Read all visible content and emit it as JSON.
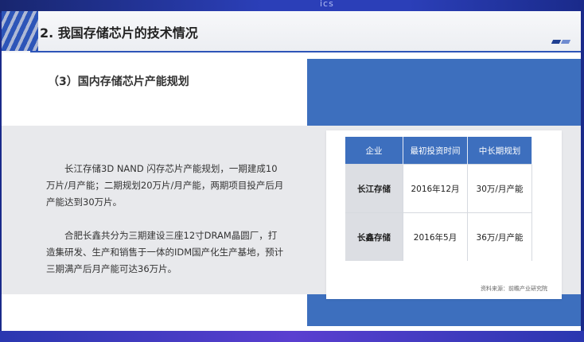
{
  "topband": {
    "text": "ics"
  },
  "header": {
    "title": "2.  我国存储芯片的技术情况"
  },
  "section": {
    "subtitle": "（3）国内存储芯片产能规划"
  },
  "paragraphs": [
    "长江存储3D NAND 闪存芯片产能规划，一期建成10万片/月产能；二期规划20万片/月产能，两期项目投产后月产能达到30万片。",
    "合肥长鑫共分为三期建设三座12寸DRAM晶圆厂，打造集研发、生产和销售于一体的IDM国产化生产基地，预计三期满产后月产能可达36万片。"
  ],
  "table": {
    "headers": [
      "企业",
      "最初投资时间",
      "中长期规划"
    ],
    "rows": [
      [
        "长江存储",
        "2016年12月",
        "30万/月产能"
      ],
      [
        "长鑫存储",
        "2016年5月",
        "36万/月产能"
      ]
    ],
    "source": "资料来源：前瞻产业研究院"
  },
  "colors": {
    "accent": "#3d6fbe",
    "header_line": "#2d55b8",
    "grey_band": "#e8e9ec"
  }
}
